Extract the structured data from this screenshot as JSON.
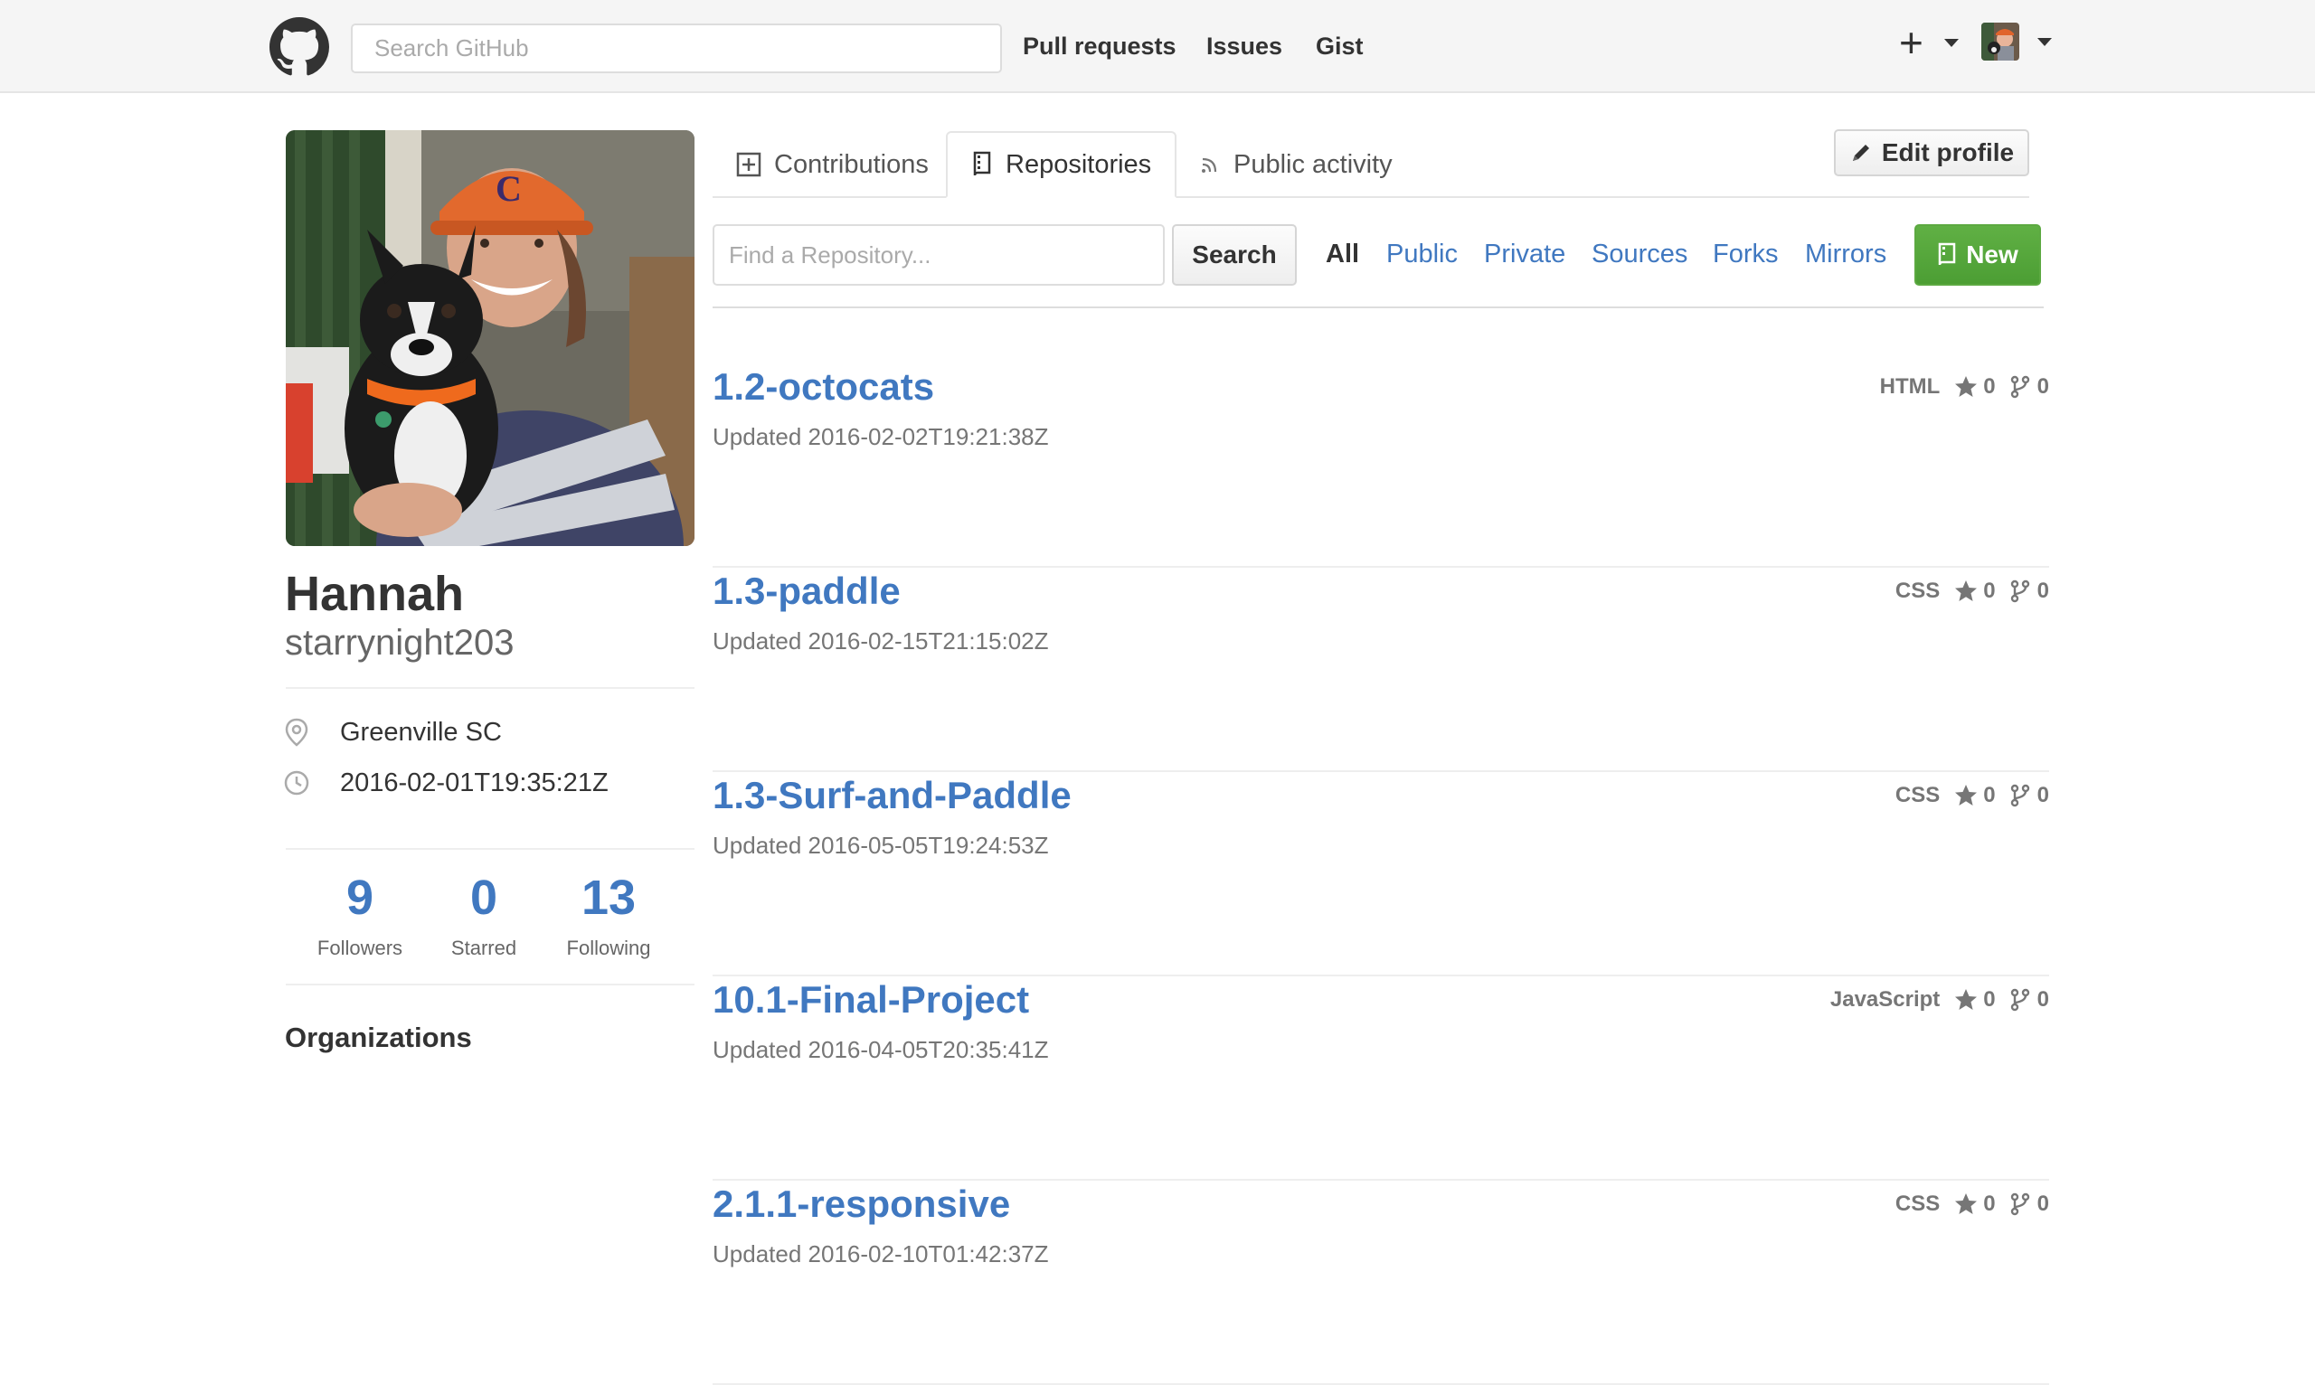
{
  "header": {
    "search_placeholder": "Search GitHub",
    "nav": [
      "Pull requests",
      "Issues",
      "Gist"
    ],
    "plus_label": "+"
  },
  "profile": {
    "fullname": "Hannah",
    "username": "starrynight203",
    "location": "Greenville SC",
    "joined": "2016-02-01T19:35:21Z",
    "stats": [
      {
        "value": "9",
        "label": "Followers"
      },
      {
        "value": "0",
        "label": "Starred"
      },
      {
        "value": "13",
        "label": "Following"
      }
    ],
    "organizations_heading": "Organizations"
  },
  "tabs": {
    "contributions": "Contributions",
    "repositories": "Repositories",
    "public_activity": "Public activity",
    "edit_profile": "Edit profile"
  },
  "filters": {
    "find_placeholder": "Find a Repository...",
    "search_label": "Search",
    "items": [
      "All",
      "Public",
      "Private",
      "Sources",
      "Forks",
      "Mirrors"
    ],
    "active": "All",
    "new_label": "New"
  },
  "repos": [
    {
      "name": "1.2-octocats",
      "updated": "Updated 2016-02-02T19:21:38Z",
      "language": "HTML",
      "stars": "0",
      "forks": "0"
    },
    {
      "name": "1.3-paddle",
      "updated": "Updated 2016-02-15T21:15:02Z",
      "language": "CSS",
      "stars": "0",
      "forks": "0"
    },
    {
      "name": "1.3-Surf-and-Paddle",
      "updated": "Updated 2016-05-05T19:24:53Z",
      "language": "CSS",
      "stars": "0",
      "forks": "0"
    },
    {
      "name": "10.1-Final-Project",
      "updated": "Updated 2016-04-05T20:35:41Z",
      "language": "JavaScript",
      "stars": "0",
      "forks": "0"
    },
    {
      "name": "2.1.1-responsive",
      "updated": "Updated 2016-02-10T01:42:37Z",
      "language": "CSS",
      "stars": "0",
      "forks": "0"
    }
  ],
  "colors": {
    "link_blue": "#4078c0",
    "new_button_green": "#55a532",
    "header_bg": "#f5f5f5"
  },
  "icons": [
    "github-logo-icon",
    "plus-icon",
    "location-pin-icon",
    "clock-icon",
    "contributions-icon",
    "repo-book-icon",
    "rss-icon",
    "pencil-icon",
    "star-icon",
    "fork-icon"
  ]
}
